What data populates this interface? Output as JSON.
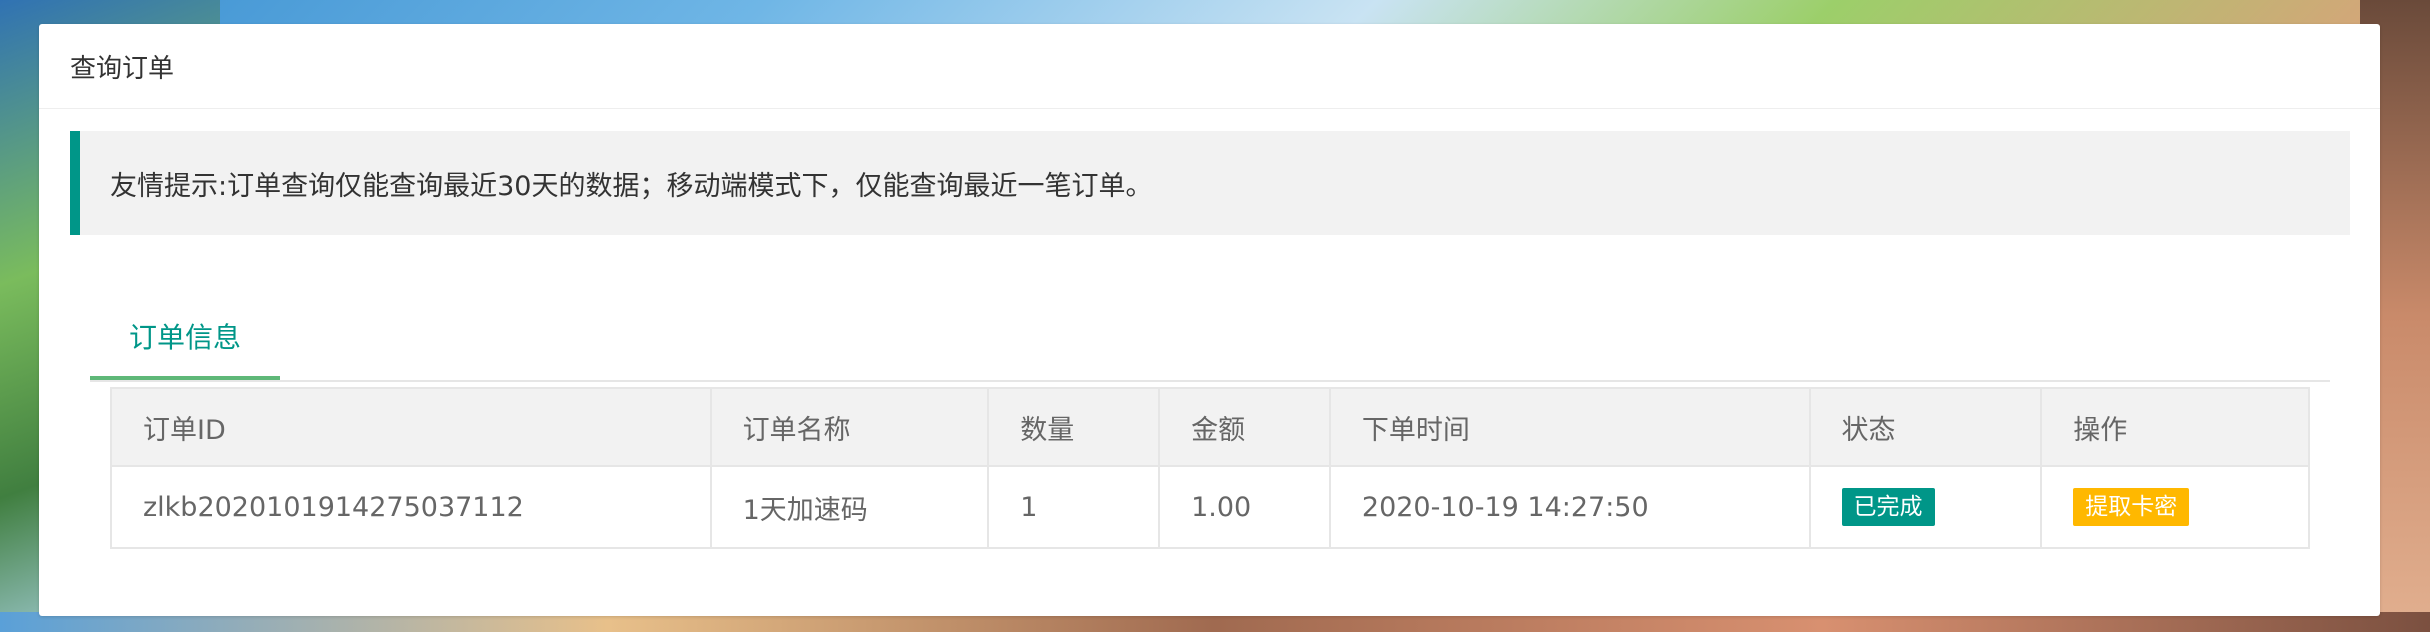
{
  "page": {
    "card_title": "查询订单",
    "notice": "友情提示:订单查询仅能查询最近30天的数据；移动端模式下，仅能查询最近一笔订单。"
  },
  "tabs": [
    {
      "label": "订单信息",
      "active": true
    }
  ],
  "table": {
    "headers": [
      "订单ID",
      "订单名称",
      "数量",
      "金额",
      "下单时间",
      "状态",
      "操作"
    ],
    "rows": [
      {
        "order_id": "zlkb2020101914275037112",
        "name": "1天加速码",
        "quantity": "1",
        "amount": "1.00",
        "time": "2020-10-19 14:27:50",
        "status": "已完成",
        "action": "提取卡密"
      }
    ]
  },
  "colors": {
    "accent": "#009688",
    "tab_underline": "#5fb878",
    "status_done": "#009688",
    "action_button": "#ffb800"
  }
}
